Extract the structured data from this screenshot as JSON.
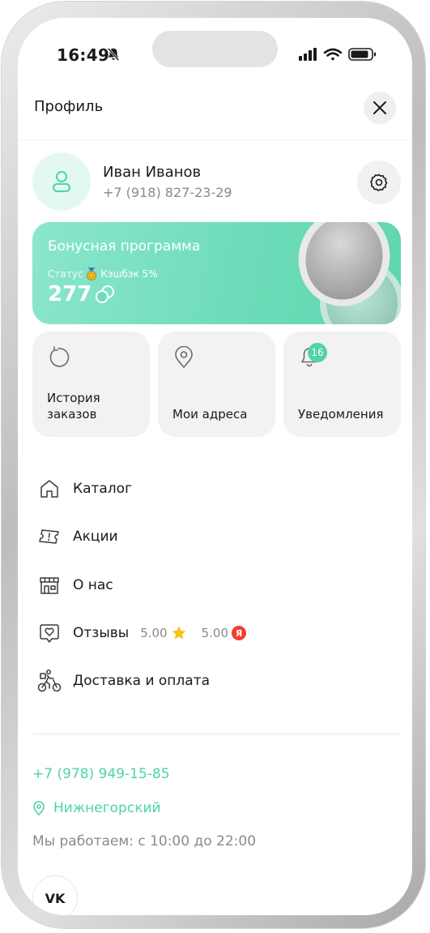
{
  "status_bar": {
    "time": "16:49"
  },
  "header": {
    "title": "Профиль"
  },
  "profile": {
    "name": "Иван Иванов",
    "phone": "+7 (918) 827-23-29"
  },
  "bonus": {
    "title": "Бонусная программа",
    "status_label": "Статус",
    "status_value": "Кэшбэк 5%",
    "points": "277"
  },
  "tiles": [
    {
      "label_line1": "История",
      "label_line2": "заказов"
    },
    {
      "label": "Мои адреса"
    },
    {
      "label": "Уведомления",
      "badge": "16"
    }
  ],
  "menu": [
    {
      "label": "Каталог",
      "icon": "home-icon"
    },
    {
      "label": "Акции",
      "icon": "ticket-icon"
    },
    {
      "label": "О нас",
      "icon": "store-icon"
    },
    {
      "label": "Отзывы",
      "icon": "heart-chat-icon"
    },
    {
      "label": "Доставка и оплата",
      "icon": "courier-bike-icon"
    }
  ],
  "reviews": {
    "rating_1": "5.00",
    "rating_1_icon": "star-icon",
    "rating_2": "5.00",
    "rating_2_icon": "yandex-icon",
    "yandex_letter": "Я"
  },
  "contacts": {
    "phone": "+7 (978) 949-15-85",
    "city": "Нижнегорский",
    "hours": "Мы работаем: с 10:00 до 22:00"
  },
  "social": {
    "vk_label": "VK"
  },
  "colors": {
    "accent": "#4fd3a8",
    "bonus_card": "#6fdcba",
    "tile_bg": "#f2f2f2",
    "yandex_red": "#f23d30",
    "star": "#f5c518"
  }
}
